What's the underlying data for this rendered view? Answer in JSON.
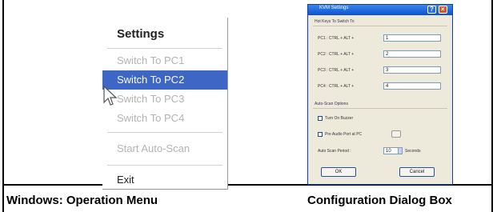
{
  "menu": {
    "title": "Settings",
    "items": [
      {
        "label": "Switch To PC1",
        "active": false
      },
      {
        "label": "Switch To PC2",
        "active": true
      },
      {
        "label": "Switch To PC3",
        "active": false
      },
      {
        "label": "Switch To PC4",
        "active": false
      }
    ],
    "auto_scan": "Start Auto-Scan",
    "exit": "Exit"
  },
  "dialog": {
    "title": "KVM Settings",
    "hotkey_group": "Hot Keys To Switch To",
    "hotkeys": [
      {
        "label": "PC1 : CTRL + ALT +",
        "value": "1"
      },
      {
        "label": "PC2 : CTRL + ALT +",
        "value": "2"
      },
      {
        "label": "PC3 : CTRL + ALT +",
        "value": "3"
      },
      {
        "label": "PC4 : CTRL + ALT +",
        "value": "4"
      }
    ],
    "scan_group": "Auto-Scan Options",
    "turn_on_buzzer": "Turn On Buzzer",
    "pre_audio": "Pre Audio Port at PC",
    "auto_scan_period_label": "Auto Scan Period :",
    "auto_scan_period_value": "10",
    "seconds": "Seconds",
    "ok": "OK",
    "cancel": "Cancel"
  },
  "captions": {
    "left": "Windows: Operation Menu",
    "right": "Configuration Dialog Box"
  }
}
